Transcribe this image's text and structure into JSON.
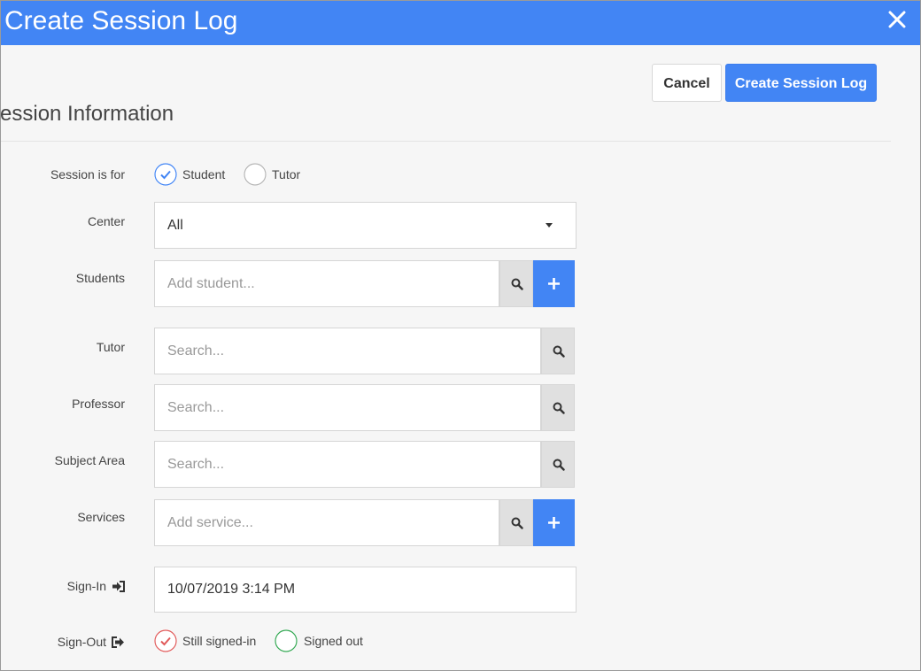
{
  "dialog": {
    "title": "Create Session Log",
    "close_icon": "close-icon"
  },
  "actions": {
    "cancel_label": "Cancel",
    "create_label": "Create Session Log"
  },
  "section": {
    "title": "Session Information"
  },
  "form": {
    "session_is_for": {
      "label": "Session is for",
      "options": [
        {
          "label": "Student",
          "selected": true
        },
        {
          "label": "Tutor",
          "selected": false
        }
      ]
    },
    "center": {
      "label": "Center",
      "value": "All"
    },
    "students": {
      "label": "Students",
      "placeholder": "Add student..."
    },
    "tutor": {
      "label": "Tutor",
      "placeholder": "Search..."
    },
    "professor": {
      "label": "Professor",
      "placeholder": "Search..."
    },
    "subject_area": {
      "label": "Subject Area",
      "placeholder": "Search..."
    },
    "services": {
      "label": "Services",
      "placeholder": "Add service..."
    },
    "sign_in": {
      "label": "Sign-In",
      "value": "10/07/2019 3:14 PM",
      "icon": "sign-in-icon"
    },
    "sign_out": {
      "label": "Sign-Out",
      "icon": "sign-out-icon",
      "options": [
        {
          "label": "Still signed-in",
          "selected": true
        },
        {
          "label": "Signed out",
          "selected": false
        }
      ]
    }
  },
  "colors": {
    "accent": "#4285f4",
    "selected_red": "#e05a5a",
    "unselected_green": "#34a853"
  }
}
